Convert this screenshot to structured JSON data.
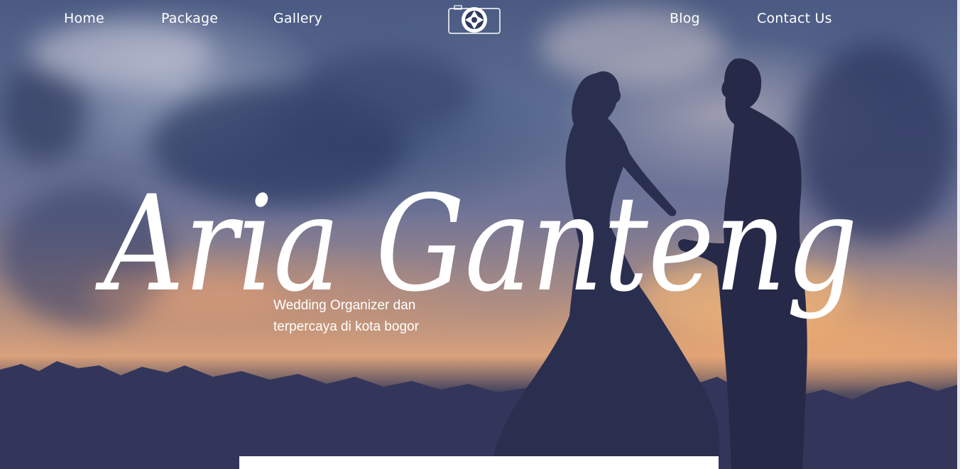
{
  "nav": {
    "items": [
      {
        "label": "Home"
      },
      {
        "label": "Package"
      },
      {
        "label": "Gallery"
      },
      {
        "label": "Blog"
      },
      {
        "label": "Contact Us"
      }
    ],
    "logo_icon": "camera-icon"
  },
  "hero": {
    "title": "Aria Ganteng",
    "subtitle_line1": "Wedding Organizer dan",
    "subtitle_line2": "terpercaya di kota bogor"
  },
  "colors": {
    "text": "#ffffff",
    "sky_dark": "#2f3350",
    "sunset": "#d9a07b"
  }
}
